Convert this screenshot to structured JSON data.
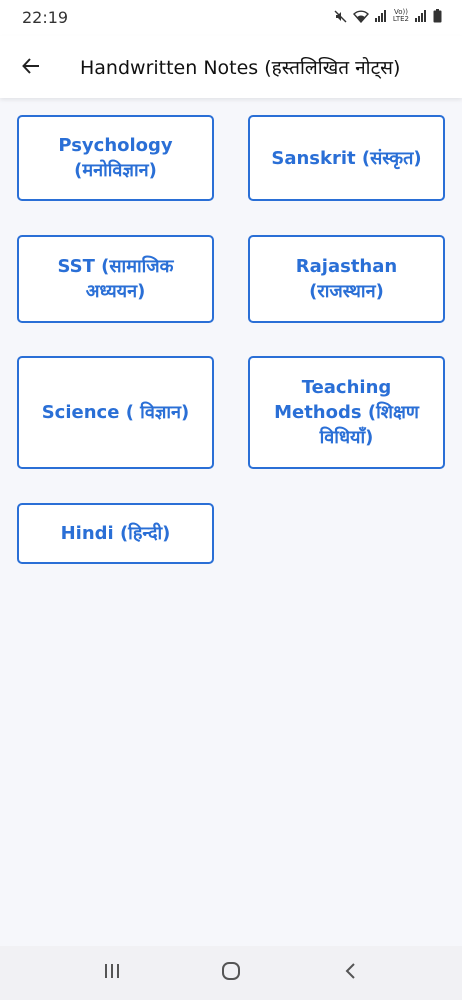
{
  "status_bar": {
    "time": "22:19",
    "icons": [
      "mute-icon",
      "wifi-icon",
      "volte-lte2-icon",
      "signal-icon",
      "signal-icon",
      "battery-icon"
    ],
    "lte_top": "Vo))",
    "lte_bottom": "LTE2"
  },
  "app_bar": {
    "back_icon": "arrow-left-icon",
    "title": "Handwritten Notes (हस्तलिखित नोट्स)"
  },
  "subjects": [
    {
      "label": "Psychology (मनोविज्ञान)"
    },
    {
      "label": "Sanskrit (संस्कृत)"
    },
    {
      "label": "SST (सामाजिक अध्ययन)"
    },
    {
      "label": "Rajasthan (राजस्थान)"
    },
    {
      "label": "Science ( विज्ञान)"
    },
    {
      "label": "Teaching Methods (शिक्षण विधियाँ)"
    },
    {
      "label": "Hindi (हिन्दी)"
    }
  ],
  "nav_bar": {
    "icons": [
      "recents-icon",
      "home-icon",
      "back-icon"
    ]
  },
  "colors": {
    "accent": "#2a6fd6",
    "background": "#f6f7fb"
  }
}
